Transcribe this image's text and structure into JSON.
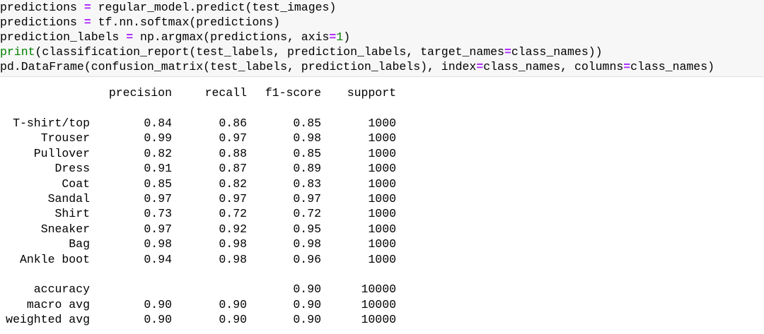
{
  "code": {
    "line1": {
      "lhs": "predictions",
      "op": "=",
      "rhs": "regular_model.predict(test_images)"
    },
    "line2": {
      "lhs": "predictions",
      "op": "=",
      "rhs": "tf.nn.softmax(predictions)"
    },
    "line3": {
      "lhs": "prediction_labels",
      "op": "=",
      "rhs_a": "np.argmax(predictions, axis",
      "rhs_eq": "=",
      "rhs_num": "1",
      "rhs_b": ")"
    },
    "line4": {
      "fn": "print",
      "a": "(classification_report(test_labels, prediction_labels, target_names",
      "eq": "=",
      "b": "class_names))"
    },
    "line5": {
      "a": "pd.DataFrame(confusion_matrix(test_labels, prediction_labels), index",
      "eq1": "=",
      "b": "class_names, columns",
      "eq2": "=",
      "c": "class_names)"
    }
  },
  "report": {
    "headers": [
      "precision",
      "recall",
      "f1-score",
      "support"
    ],
    "rows": [
      {
        "label": "T-shirt/top",
        "precision": "0.84",
        "recall": "0.86",
        "f1": "0.85",
        "support": "1000"
      },
      {
        "label": "Trouser",
        "precision": "0.99",
        "recall": "0.97",
        "f1": "0.98",
        "support": "1000"
      },
      {
        "label": "Pullover",
        "precision": "0.82",
        "recall": "0.88",
        "f1": "0.85",
        "support": "1000"
      },
      {
        "label": "Dress",
        "precision": "0.91",
        "recall": "0.87",
        "f1": "0.89",
        "support": "1000"
      },
      {
        "label": "Coat",
        "precision": "0.85",
        "recall": "0.82",
        "f1": "0.83",
        "support": "1000"
      },
      {
        "label": "Sandal",
        "precision": "0.97",
        "recall": "0.97",
        "f1": "0.97",
        "support": "1000"
      },
      {
        "label": "Shirt",
        "precision": "0.73",
        "recall": "0.72",
        "f1": "0.72",
        "support": "1000"
      },
      {
        "label": "Sneaker",
        "precision": "0.97",
        "recall": "0.92",
        "f1": "0.95",
        "support": "1000"
      },
      {
        "label": "Bag",
        "precision": "0.98",
        "recall": "0.98",
        "f1": "0.98",
        "support": "1000"
      },
      {
        "label": "Ankle boot",
        "precision": "0.94",
        "recall": "0.98",
        "f1": "0.96",
        "support": "1000"
      }
    ],
    "summary": [
      {
        "label": "accuracy",
        "precision": "",
        "recall": "",
        "f1": "0.90",
        "support": "10000"
      },
      {
        "label": "macro avg",
        "precision": "0.90",
        "recall": "0.90",
        "f1": "0.90",
        "support": "10000"
      },
      {
        "label": "weighted avg",
        "precision": "0.90",
        "recall": "0.90",
        "f1": "0.90",
        "support": "10000"
      }
    ]
  }
}
